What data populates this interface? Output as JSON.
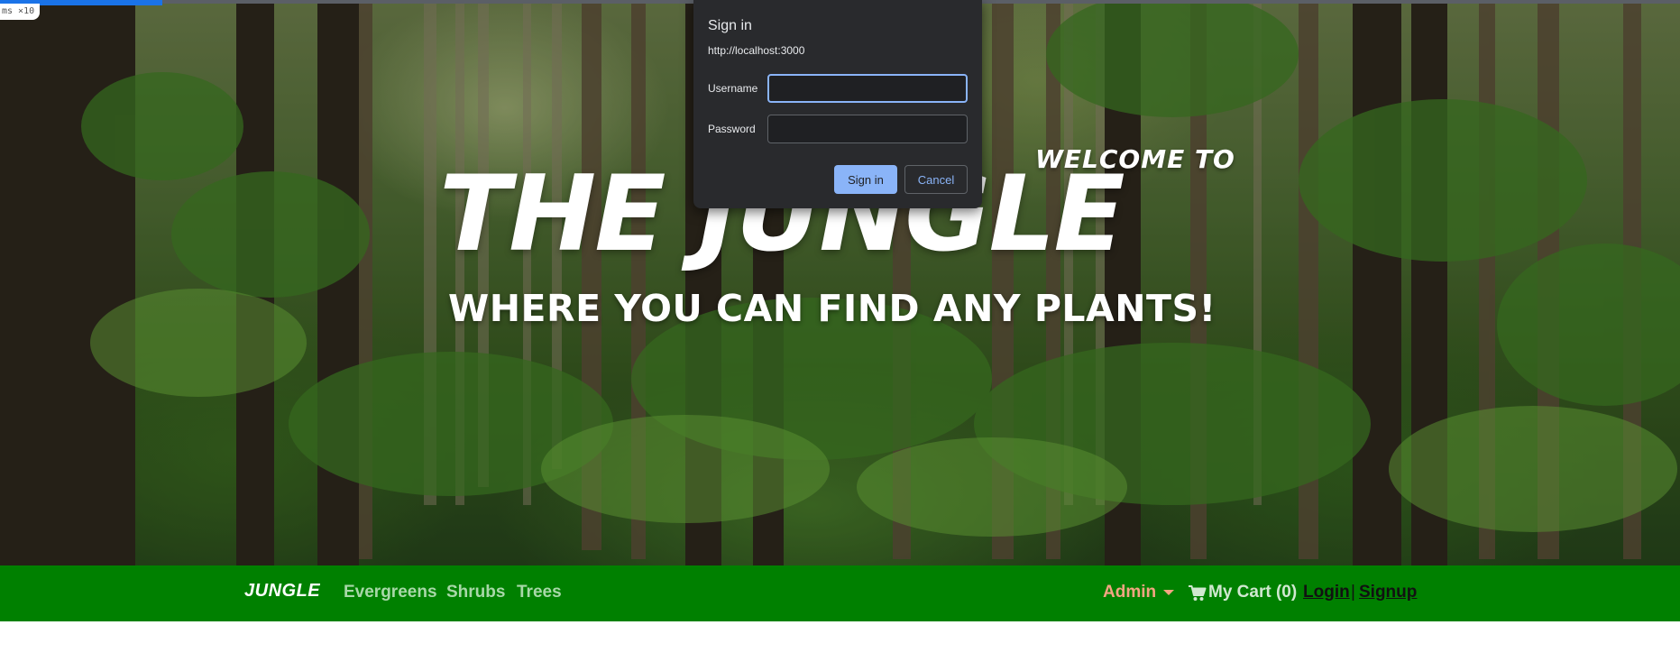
{
  "browser": {
    "fps_badge": "ms ×10",
    "accent_color": "#1a73e8"
  },
  "hero": {
    "welcome": "WELCOME TO",
    "title": "THE JUNGLE",
    "tagline": "WHERE YOU CAN FIND ANY PLANTS!"
  },
  "navbar": {
    "background_color": "#008000",
    "brand": "JUNGLE",
    "links": [
      "Evergreens",
      "Shrubs",
      "Trees"
    ],
    "admin_label": "Admin",
    "cart_icon": "shopping-cart-icon",
    "cart_label": "My Cart (0)",
    "login_label": "Login",
    "separator": "|",
    "signup_label": "Signup"
  },
  "sign_in_dialog": {
    "title": "Sign in",
    "origin": "http://localhost:3000",
    "username_label": "Username",
    "username_value": "",
    "password_label": "Password",
    "password_value": "",
    "sign_in_button": "Sign in",
    "cancel_button": "Cancel",
    "primary_color": "#8ab4f8"
  }
}
